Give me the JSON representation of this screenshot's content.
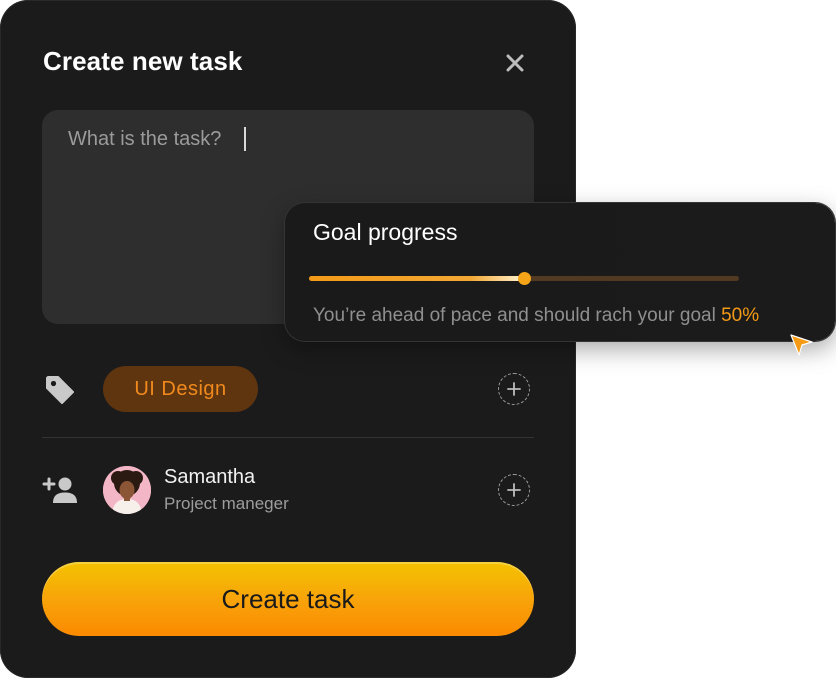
{
  "modal": {
    "title": "Create new task",
    "close_icon": "close-icon",
    "task_placeholder": "What is the task?",
    "task_value": ""
  },
  "tags": {
    "icon": "tag-icon",
    "items": [
      {
        "label": "UI Design"
      }
    ],
    "add_icon": "plus-icon"
  },
  "assignee": {
    "icon": "add-user-icon",
    "name": "Samantha",
    "role": "Project maneger",
    "add_icon": "plus-icon"
  },
  "actions": {
    "create_label": "Create task"
  },
  "goal_popup": {
    "title": "Goal progress",
    "progress": 0.5,
    "description": "You’re ahead of pace and should rach your goal",
    "percent_label": "50%"
  },
  "colors": {
    "accent": "#f39a16",
    "card_bg": "#1c1b1c",
    "chip_bg": "#5f3510",
    "button_gradient_top": "#f3c300",
    "button_gradient_bottom": "#fb8a00"
  }
}
